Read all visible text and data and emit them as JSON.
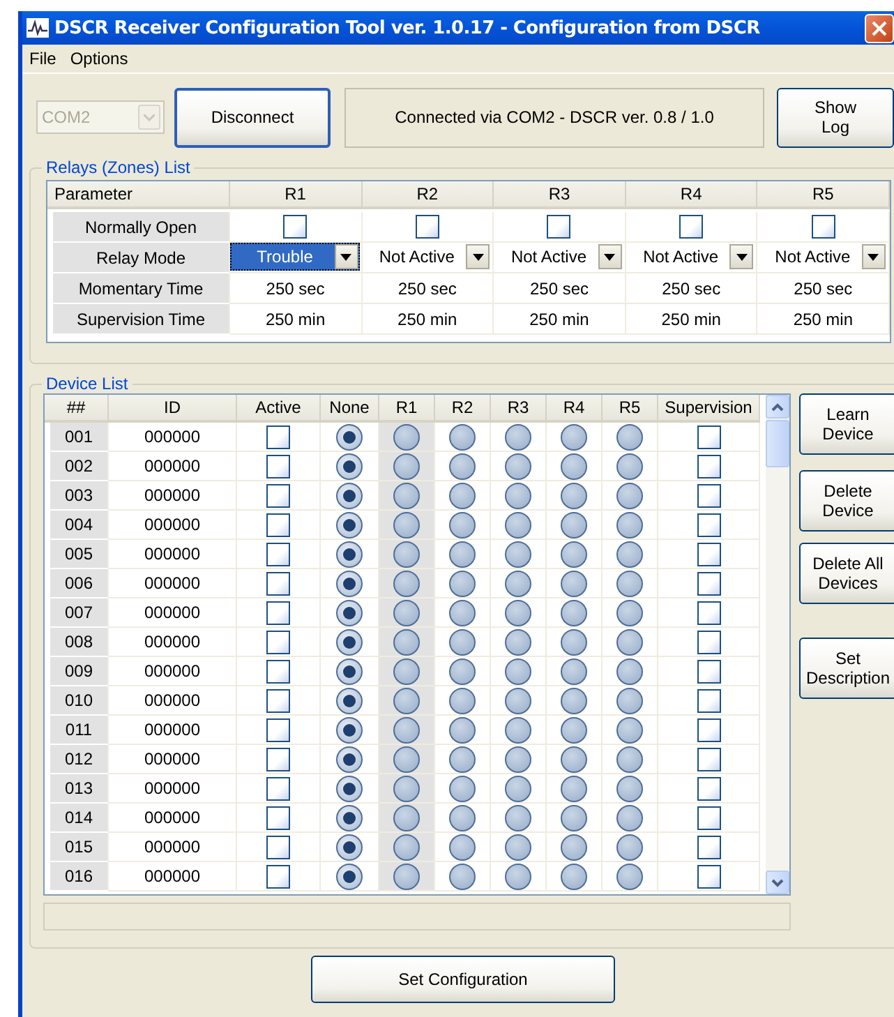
{
  "window": {
    "title": "DSCR Receiver Configuration Tool ver. 1.0.17 - Configuration from DSCR"
  },
  "menu": [
    "File",
    "Options"
  ],
  "connection": {
    "port": "COM2",
    "port_disabled": true,
    "connect_button": "Disconnect",
    "status": "Connected via COM2 - DSCR ver. 0.8 / 1.0",
    "log_button": "Show Log"
  },
  "relays": {
    "title": "Relays (Zones) List",
    "columns": [
      "Parameter",
      "R1",
      "R2",
      "R3",
      "R4",
      "R5"
    ],
    "rows": [
      {
        "kind": "checkbox",
        "cells": [
          {
            "value": "Normally Open"
          },
          {
            "checked": false
          },
          {
            "checked": false
          },
          {
            "checked": false
          },
          {
            "checked": false
          },
          {
            "checked": false
          }
        ]
      },
      {
        "kind": "dropdown",
        "cells": [
          {
            "value": "Relay Mode"
          },
          {
            "value": "Trouble",
            "selected": true
          },
          {
            "value": "Not Active",
            "selected": false
          },
          {
            "value": "Not Active",
            "selected": false
          },
          {
            "value": "Not Active",
            "selected": false
          },
          {
            "value": "Not Active",
            "selected": false
          }
        ]
      },
      {
        "kind": "text",
        "cells": [
          {
            "value": "Momentary Time"
          },
          {
            "value": "250 sec"
          },
          {
            "value": "250 sec"
          },
          {
            "value": "250 sec"
          },
          {
            "value": "250 sec"
          },
          {
            "value": "250 sec"
          }
        ]
      },
      {
        "kind": "text",
        "cells": [
          {
            "value": "Supervision Time"
          },
          {
            "value": "250 min"
          },
          {
            "value": "250 min"
          },
          {
            "value": "250 min"
          },
          {
            "value": "250 min"
          },
          {
            "value": "250 min"
          }
        ]
      }
    ]
  },
  "devices": {
    "title": "Device List",
    "columns": [
      "##",
      "ID",
      "Active",
      "None",
      "R1",
      "R2",
      "R3",
      "R4",
      "R5",
      "Supervision"
    ],
    "rows": [
      {
        "number": "001",
        "id": "000000",
        "active": false,
        "outputs": [
          {
            "selected": true
          },
          {
            "selected": false
          },
          {
            "selected": false
          },
          {
            "selected": false
          },
          {
            "selected": false
          },
          {
            "selected": false
          }
        ],
        "supervision": false
      },
      {
        "number": "002",
        "id": "000000",
        "active": false,
        "outputs": [
          {
            "selected": true
          },
          {
            "selected": false
          },
          {
            "selected": false
          },
          {
            "selected": false
          },
          {
            "selected": false
          },
          {
            "selected": false
          }
        ],
        "supervision": false
      },
      {
        "number": "003",
        "id": "000000",
        "active": false,
        "outputs": [
          {
            "selected": true
          },
          {
            "selected": false
          },
          {
            "selected": false
          },
          {
            "selected": false
          },
          {
            "selected": false
          },
          {
            "selected": false
          }
        ],
        "supervision": false
      },
      {
        "number": "004",
        "id": "000000",
        "active": false,
        "outputs": [
          {
            "selected": true
          },
          {
            "selected": false
          },
          {
            "selected": false
          },
          {
            "selected": false
          },
          {
            "selected": false
          },
          {
            "selected": false
          }
        ],
        "supervision": false
      },
      {
        "number": "005",
        "id": "000000",
        "active": false,
        "outputs": [
          {
            "selected": true
          },
          {
            "selected": false
          },
          {
            "selected": false
          },
          {
            "selected": false
          },
          {
            "selected": false
          },
          {
            "selected": false
          }
        ],
        "supervision": false
      },
      {
        "number": "006",
        "id": "000000",
        "active": false,
        "outputs": [
          {
            "selected": true
          },
          {
            "selected": false
          },
          {
            "selected": false
          },
          {
            "selected": false
          },
          {
            "selected": false
          },
          {
            "selected": false
          }
        ],
        "supervision": false
      },
      {
        "number": "007",
        "id": "000000",
        "active": false,
        "outputs": [
          {
            "selected": true
          },
          {
            "selected": false
          },
          {
            "selected": false
          },
          {
            "selected": false
          },
          {
            "selected": false
          },
          {
            "selected": false
          }
        ],
        "supervision": false
      },
      {
        "number": "008",
        "id": "000000",
        "active": false,
        "outputs": [
          {
            "selected": true
          },
          {
            "selected": false
          },
          {
            "selected": false
          },
          {
            "selected": false
          },
          {
            "selected": false
          },
          {
            "selected": false
          }
        ],
        "supervision": false
      },
      {
        "number": "009",
        "id": "000000",
        "active": false,
        "outputs": [
          {
            "selected": true
          },
          {
            "selected": false
          },
          {
            "selected": false
          },
          {
            "selected": false
          },
          {
            "selected": false
          },
          {
            "selected": false
          }
        ],
        "supervision": false
      },
      {
        "number": "010",
        "id": "000000",
        "active": false,
        "outputs": [
          {
            "selected": true
          },
          {
            "selected": false
          },
          {
            "selected": false
          },
          {
            "selected": false
          },
          {
            "selected": false
          },
          {
            "selected": false
          }
        ],
        "supervision": false
      },
      {
        "number": "011",
        "id": "000000",
        "active": false,
        "outputs": [
          {
            "selected": true
          },
          {
            "selected": false
          },
          {
            "selected": false
          },
          {
            "selected": false
          },
          {
            "selected": false
          },
          {
            "selected": false
          }
        ],
        "supervision": false
      },
      {
        "number": "012",
        "id": "000000",
        "active": false,
        "outputs": [
          {
            "selected": true
          },
          {
            "selected": false
          },
          {
            "selected": false
          },
          {
            "selected": false
          },
          {
            "selected": false
          },
          {
            "selected": false
          }
        ],
        "supervision": false
      },
      {
        "number": "013",
        "id": "000000",
        "active": false,
        "outputs": [
          {
            "selected": true
          },
          {
            "selected": false
          },
          {
            "selected": false
          },
          {
            "selected": false
          },
          {
            "selected": false
          },
          {
            "selected": false
          }
        ],
        "supervision": false
      },
      {
        "number": "014",
        "id": "000000",
        "active": false,
        "outputs": [
          {
            "selected": true
          },
          {
            "selected": false
          },
          {
            "selected": false
          },
          {
            "selected": false
          },
          {
            "selected": false
          },
          {
            "selected": false
          }
        ],
        "supervision": false
      },
      {
        "number": "015",
        "id": "000000",
        "active": false,
        "outputs": [
          {
            "selected": true
          },
          {
            "selected": false
          },
          {
            "selected": false
          },
          {
            "selected": false
          },
          {
            "selected": false
          },
          {
            "selected": false
          }
        ],
        "supervision": false
      },
      {
        "number": "016",
        "id": "000000",
        "active": false,
        "outputs": [
          {
            "selected": true
          },
          {
            "selected": false
          },
          {
            "selected": false
          },
          {
            "selected": false
          },
          {
            "selected": false
          },
          {
            "selected": false
          }
        ],
        "supervision": false
      }
    ],
    "buttons": [
      "Learn Device",
      "Delete Device",
      "Delete All Devices",
      "Set Description"
    ]
  },
  "set_button": "Set Configuration"
}
